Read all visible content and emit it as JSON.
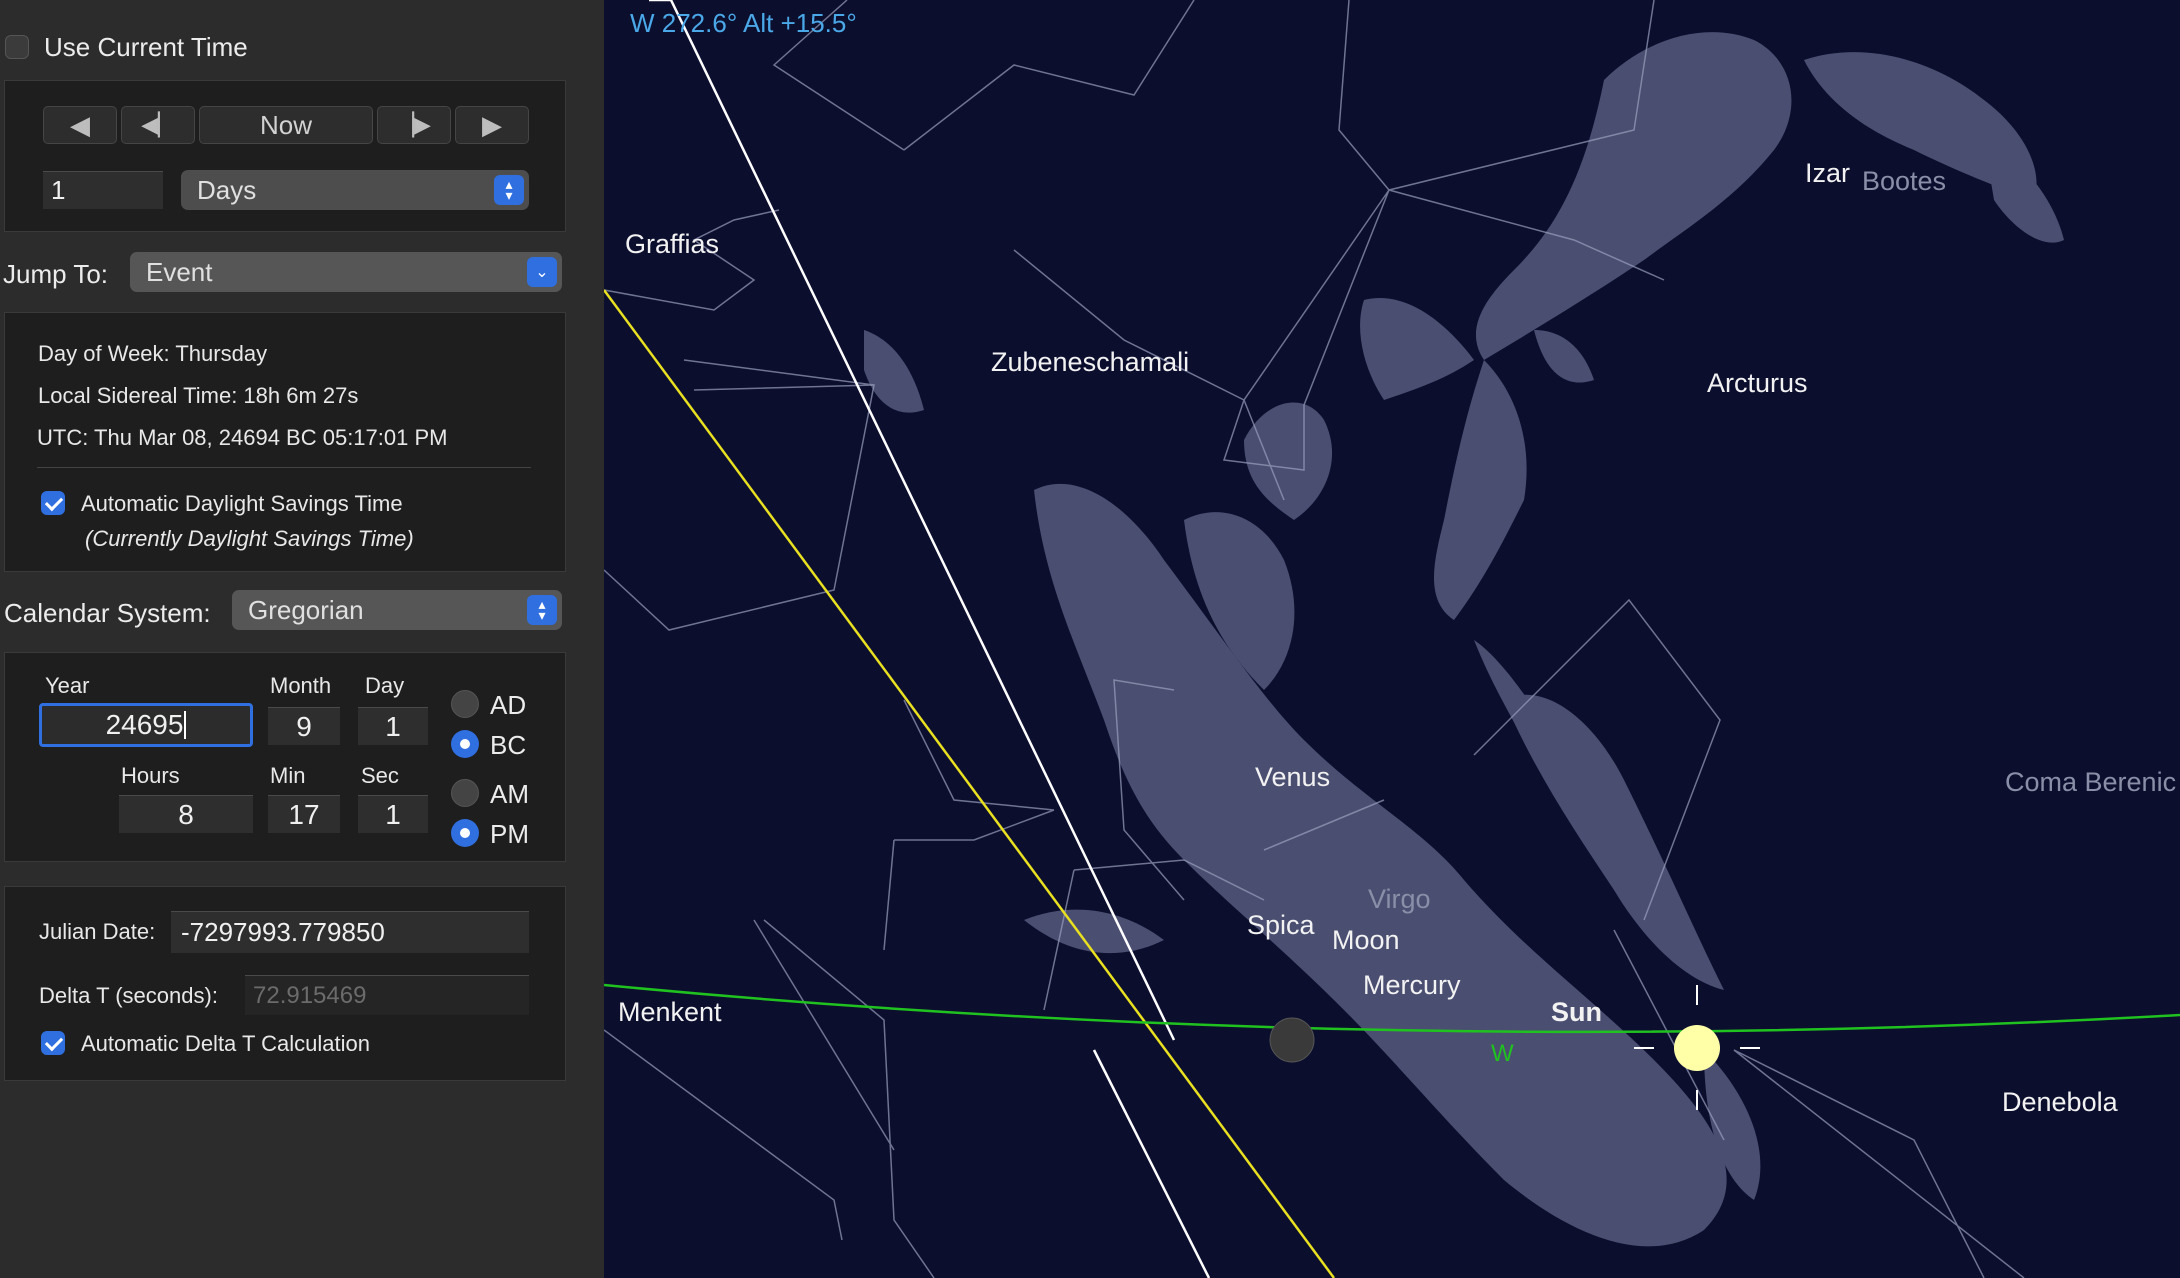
{
  "time_panel": {
    "use_current_time_label": "Use Current Time",
    "use_current_time_checked": false,
    "now_label": "Now",
    "step_amount": "1",
    "step_unit": "Days",
    "jump_to_label": "Jump To:",
    "jump_to_value": "Event"
  },
  "info": {
    "day_of_week": "Day of Week:  Thursday",
    "sidereal_time": "Local Sidereal Time:  18h 6m 27s",
    "utc": "UTC:  Thu Mar 08, 24694 BC 05:17:01 PM",
    "auto_dst_label": "Automatic Daylight Savings Time",
    "auto_dst_checked": true,
    "dst_status": "(Currently Daylight Savings Time)"
  },
  "calendar": {
    "label": "Calendar System:",
    "value": "Gregorian"
  },
  "date_fields": {
    "year_label": "Year",
    "year": "24695",
    "month_label": "Month",
    "month": "9",
    "day_label": "Day",
    "day": "1",
    "hours_label": "Hours",
    "hours": "8",
    "min_label": "Min",
    "min": "17",
    "sec_label": "Sec",
    "sec": "1",
    "ad_label": "AD",
    "bc_label": "BC",
    "am_label": "AM",
    "pm_label": "PM",
    "era_selected": "BC",
    "meridiem_selected": "PM"
  },
  "julian": {
    "julian_date_label": "Julian Date:",
    "julian_date": "-7297993.779850",
    "delta_t_label": "Delta T (seconds):",
    "delta_t": "72.915469",
    "auto_delta_t_label": "Automatic Delta T Calculation",
    "auto_delta_t_checked": true
  },
  "sky": {
    "direction_readout": "W 272.6° Alt +15.5°",
    "horizon_marker": "W",
    "stars": [
      "Graffias",
      "Zubeneschamali",
      "Izar",
      "Arcturus",
      "Menkent",
      "Denebola",
      "Spica"
    ],
    "constellations": [
      "Bootes",
      "Coma Berenic",
      "Virgo"
    ],
    "planets": [
      "Venus",
      "Moon",
      "Mercury",
      "Sun"
    ],
    "colors": {
      "background": "#0c0e2e",
      "horizon_line": "#1fc21f",
      "ecliptic_line": "#e8e020",
      "meridian_line": "#ffffff",
      "readout": "#4aa8e8"
    }
  }
}
